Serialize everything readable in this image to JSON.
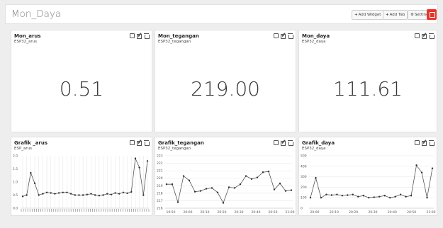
{
  "dashboard": {
    "title": "Mon_Daya"
  },
  "toolbar": {
    "add_widget": "Add Widget",
    "add_tab": "Add Tab",
    "settings": "Settings"
  },
  "widgets": [
    {
      "title": "Mon_arus",
      "topic": "ESP32_arus",
      "value": "0.51"
    },
    {
      "title": "Mon_tegangan",
      "topic": "ESP32_tegangan",
      "value": "219.00"
    },
    {
      "title": "Mon_daya",
      "topic": "ESP32_daya",
      "value": "111.61"
    }
  ],
  "charts": [
    {
      "title": "Grafik _arus",
      "topic": "ESP_arus"
    },
    {
      "title": "Grafik_tegangan",
      "topic": "ESP32_tegangan"
    },
    {
      "title": "Grafik_daya",
      "topic": "ESP32_daya"
    }
  ],
  "chart_data": [
    {
      "type": "line",
      "title": "Grafik _arus",
      "ylim": [
        0,
        2
      ],
      "yticks": [
        "0.0",
        "0.5",
        "1.0",
        "1.5",
        "2.0"
      ],
      "x_dense_labels": true,
      "grid": "vertical",
      "values": [
        0.45,
        0.5,
        1.35,
        0.95,
        0.5,
        0.55,
        0.6,
        0.58,
        0.55,
        0.58,
        0.6,
        0.6,
        0.55,
        0.5,
        0.5,
        0.5,
        0.52,
        0.55,
        0.5,
        0.48,
        0.5,
        0.55,
        0.52,
        0.58,
        0.55,
        0.6,
        0.57,
        0.62,
        1.9,
        1.55,
        0.5,
        1.8
      ]
    },
    {
      "type": "line",
      "title": "Grafik_tegangan",
      "ylim": [
        216,
        223
      ],
      "yticks": [
        "216",
        "217",
        "218",
        "219",
        "220",
        "221",
        "222",
        "223"
      ],
      "xticks": [
        "19:50",
        "20:00",
        "20:10",
        "20:20",
        "20:30",
        "20:40",
        "20:50",
        "21:00"
      ],
      "grid": "horizontal",
      "values": [
        219.2,
        219.2,
        216.8,
        220.3,
        219.7,
        218.2,
        218.3,
        218.6,
        218.7,
        218.1,
        216.7,
        218.8,
        218.7,
        219.2,
        220.3,
        219.9,
        220.1,
        220.8,
        220.9,
        218.5,
        219.3,
        218.3,
        218.4
      ]
    },
    {
      "type": "line",
      "title": "Grafik_daya",
      "ylim": [
        0,
        500
      ],
      "yticks": [
        "0",
        "100",
        "200",
        "300",
        "400",
        "500"
      ],
      "xticks": [
        "20:00",
        "20:10",
        "20:20",
        "20:30",
        "20:40",
        "20:50",
        "21:00"
      ],
      "grid": "horizontal",
      "values": [
        100,
        290,
        100,
        130,
        125,
        130,
        120,
        125,
        130,
        110,
        120,
        100,
        105,
        110,
        120,
        100,
        110,
        130,
        110,
        120,
        410,
        340,
        100,
        380
      ]
    }
  ]
}
